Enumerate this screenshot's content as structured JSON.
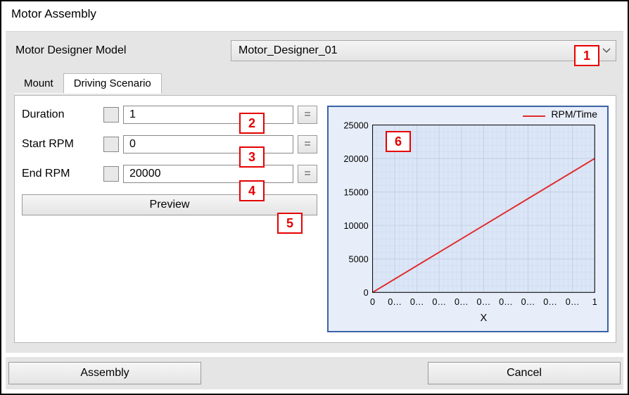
{
  "window": {
    "title": "Motor Assembly"
  },
  "model": {
    "label": "Motor Designer Model",
    "selected": "Motor_Designer_01"
  },
  "tabs": {
    "items": [
      {
        "label": "Mount",
        "active": false
      },
      {
        "label": "Driving Scenario",
        "active": true
      }
    ]
  },
  "fields": {
    "duration": {
      "label": "Duration",
      "value": "1"
    },
    "start_rpm": {
      "label": "Start RPM",
      "value": "0"
    },
    "end_rpm": {
      "label": "End RPM",
      "value": "20000"
    }
  },
  "buttons": {
    "preview": "Preview",
    "assembly": "Assembly",
    "cancel": "Cancel"
  },
  "callouts": {
    "1": "1",
    "2": "2",
    "3": "3",
    "4": "4",
    "5": "5",
    "6": "6"
  },
  "chart_data": {
    "type": "line",
    "title": "",
    "xlabel": "X",
    "ylabel": "",
    "xlim": [
      0,
      1
    ],
    "ylim": [
      0,
      25000
    ],
    "x_ticks_display": [
      "0",
      "0…",
      "0…",
      "0…",
      "0…",
      "0…",
      "0…",
      "0…",
      "0…",
      "0…",
      "1"
    ],
    "y_ticks": [
      0,
      5000,
      10000,
      15000,
      20000,
      25000
    ],
    "series": [
      {
        "name": "RPM/Time",
        "color": "#e12b2b",
        "x": [
          0,
          0.1,
          0.2,
          0.3,
          0.4,
          0.5,
          0.6,
          0.7,
          0.8,
          0.9,
          1.0
        ],
        "y": [
          0,
          2000,
          4000,
          6000,
          8000,
          10000,
          12000,
          14000,
          16000,
          18000,
          20000
        ]
      }
    ]
  }
}
